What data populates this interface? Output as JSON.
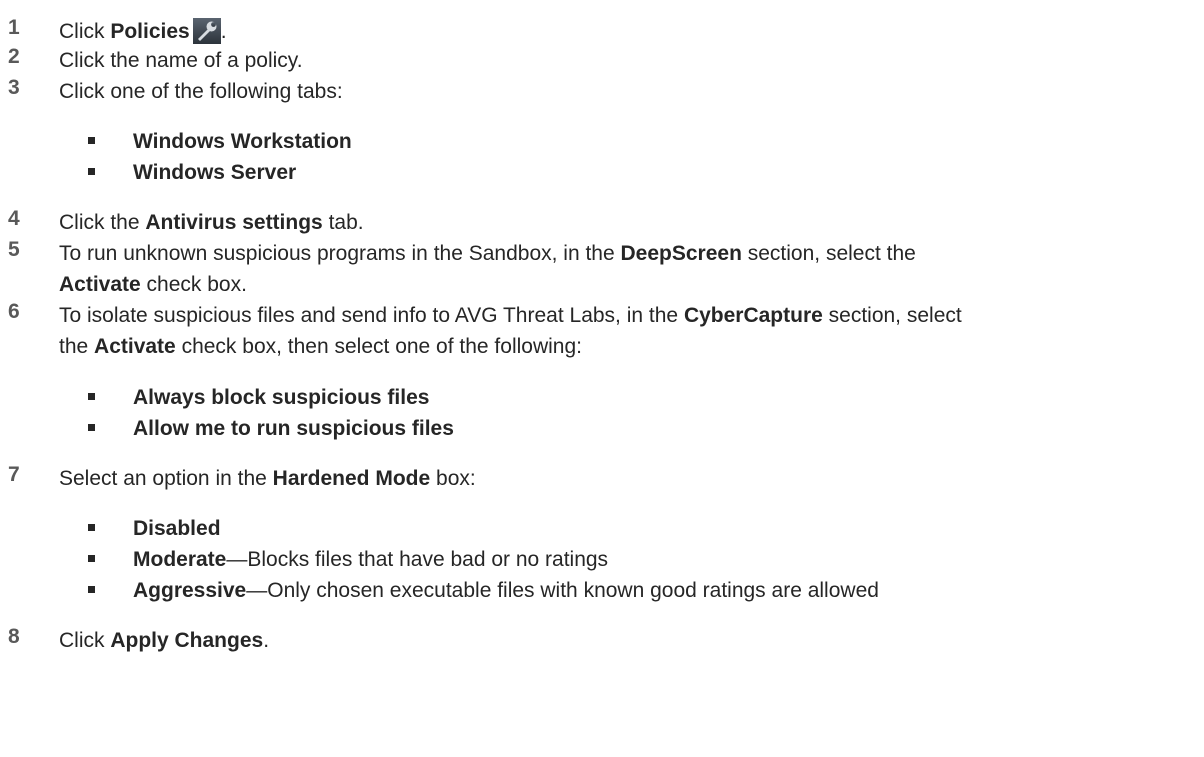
{
  "steps": [
    {
      "num": "1",
      "pre": "Click ",
      "bold": "Policies",
      "post": "."
    },
    {
      "num": "2",
      "text": "Click the name of a policy."
    },
    {
      "num": "3",
      "text": "Click one of the following tabs:"
    },
    {
      "num": "4",
      "pre": "Click the ",
      "bold": "Antivirus settings",
      "post": " tab."
    },
    {
      "num": "5",
      "line1_pre": "To run unknown suspicious programs in the Sandbox, in the ",
      "line1_bold": "DeepScreen",
      "line1_post": " section, select the",
      "line2_bold": "Activate",
      "line2_post": " check box."
    },
    {
      "num": "6",
      "line1_pre": "To isolate suspicious files and send info to AVG Threat Labs, in the ",
      "line1_bold": "CyberCapture",
      "line1_post": " section, select",
      "line2_pre": "the ",
      "line2_bold": "Activate",
      "line2_post": " check box, then select one of the following:"
    },
    {
      "num": "7",
      "pre": "Select an option in the ",
      "bold": "Hardened Mode",
      "post": " box:"
    },
    {
      "num": "8",
      "pre": "Click ",
      "bold": "Apply Changes",
      "post": "."
    }
  ],
  "tabs_bullets": [
    "Windows Workstation",
    "Windows Server"
  ],
  "cyber_bullets": [
    "Always block suspicious files",
    "Allow me to run suspicious files"
  ],
  "hardened_bullets": [
    {
      "bold": "Disabled",
      "rest": ""
    },
    {
      "bold": "Moderate",
      "rest": "—Blocks files that have bad or no ratings"
    },
    {
      "bold": "Aggressive",
      "rest": "—Only chosen executable files with known good ratings are allowed"
    }
  ],
  "icons": {
    "policies": "wrench-icon"
  }
}
